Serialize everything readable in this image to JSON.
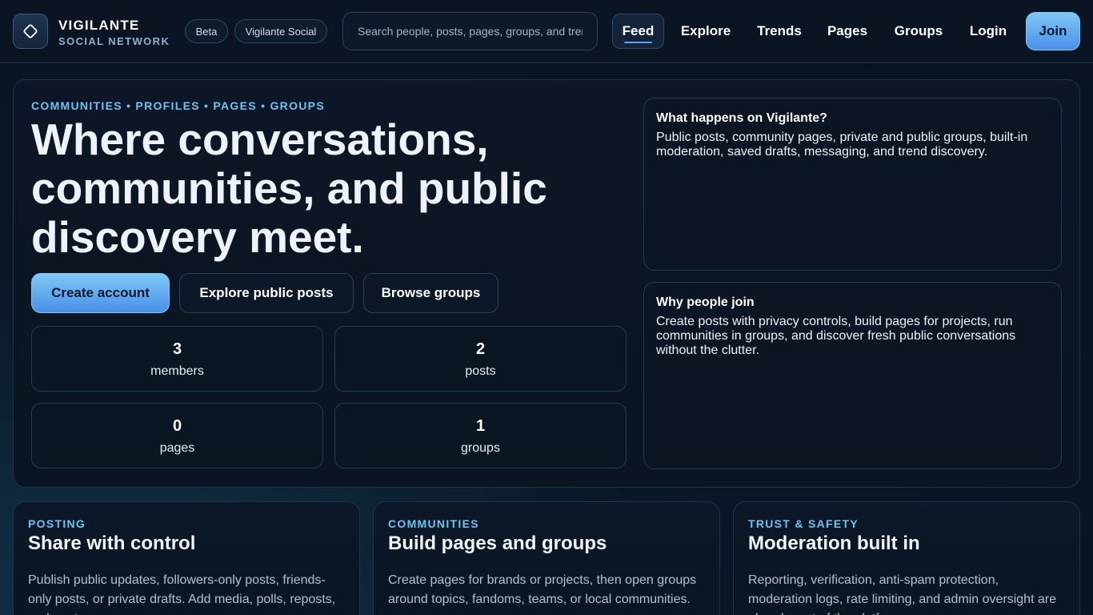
{
  "header": {
    "brand_name": "VIGILANTE",
    "brand_sub": "SOCIAL NETWORK",
    "badges": [
      "Beta",
      "Vigilante Social"
    ],
    "search_placeholder": "Search people, posts, pages, groups, and trends",
    "nav": [
      "Feed",
      "Explore",
      "Trends",
      "Pages",
      "Groups",
      "Login"
    ],
    "active_nav": "Feed",
    "join_label": "Join"
  },
  "hero": {
    "eyebrow": "COMMUNITIES • PROFILES • PAGES • GROUPS",
    "title": "Where conversations, communities, and public discovery meet.",
    "buttons": {
      "create": "Create account",
      "explore": "Explore public posts",
      "browse": "Browse groups"
    },
    "stats": [
      {
        "value": "3",
        "label": "members"
      },
      {
        "value": "2",
        "label": "posts"
      },
      {
        "value": "0",
        "label": "pages"
      },
      {
        "value": "1",
        "label": "groups"
      }
    ],
    "info_cards": [
      {
        "title": "What happens on Vigilante?",
        "body": "Public posts, community pages, private and public groups, built-in moderation, saved drafts, messaging, and trend discovery."
      },
      {
        "title": "Why people join",
        "body": "Create posts with privacy controls, build pages for projects, run communities in groups, and discover fresh public conversations without the clutter."
      }
    ]
  },
  "features": [
    {
      "kicker": "POSTING",
      "title": "Share with control",
      "body": "Publish public updates, followers-only posts, friends-only posts, or private drafts. Add media, polls, reposts, and quotes."
    },
    {
      "kicker": "COMMUNITIES",
      "title": "Build pages and groups",
      "body": "Create pages for brands or projects, then open groups around topics, fandoms, teams, or local communities."
    },
    {
      "kicker": "TRUST & SAFETY",
      "title": "Moderation built in",
      "body": "Reporting, verification, anti-spam protection, moderation logs, rate limiting, and admin oversight are already part of the platform."
    }
  ],
  "colors": {
    "accent": "#6ec3f2",
    "button_gradient_top": "#7ec8f6",
    "button_gradient_bottom": "#4a8fe8",
    "background": "#081220"
  },
  "icons": {
    "logo": "diamond-logo-icon"
  }
}
